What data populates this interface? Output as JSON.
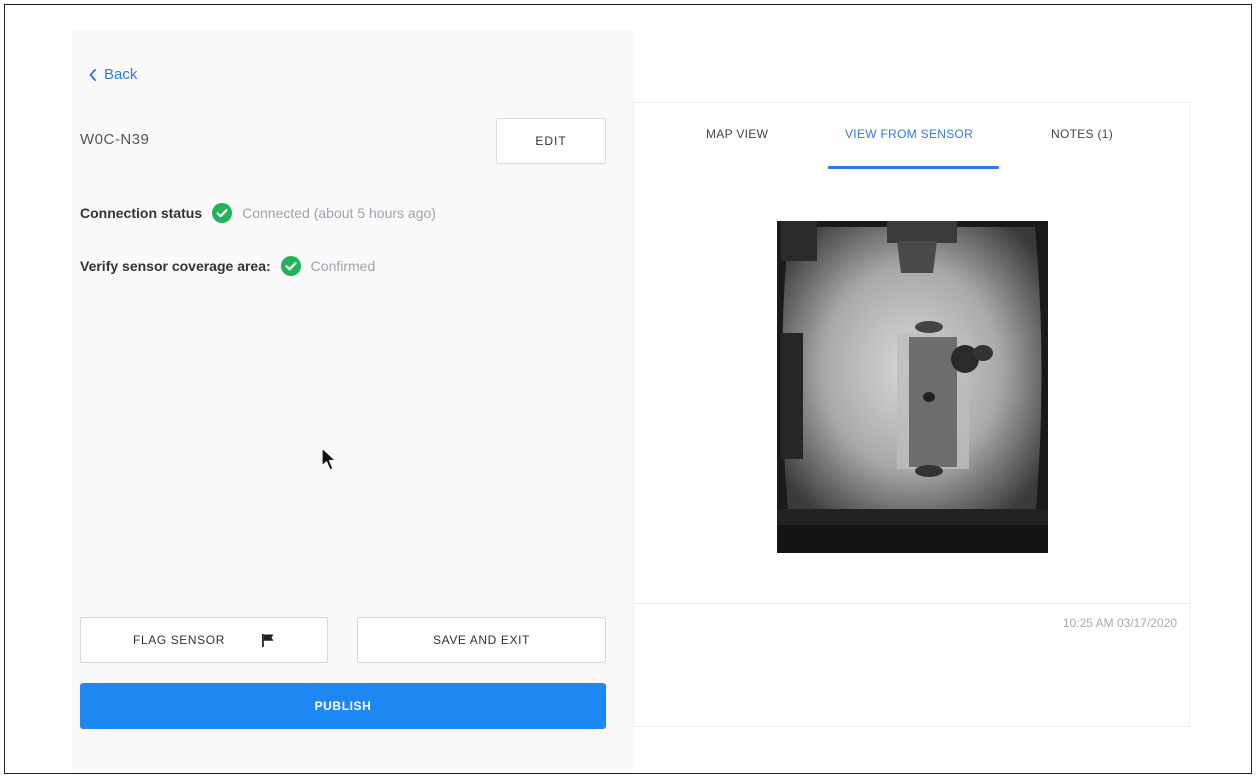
{
  "nav": {
    "back_label": "Back"
  },
  "sensor": {
    "id": "W0C-N39",
    "edit_label": "EDIT"
  },
  "status": {
    "connection": {
      "label": "Connection status",
      "value": "Connected (about 5 hours ago)"
    },
    "coverage": {
      "label": "Verify sensor coverage area:",
      "value": "Confirmed"
    }
  },
  "actions": {
    "flag_label": "FLAG SENSOR",
    "save_exit_label": "SAVE AND EXIT",
    "publish_label": "PUBLISH"
  },
  "panel": {
    "tabs": [
      {
        "label": "MAP VIEW",
        "active": false
      },
      {
        "label": "VIEW FROM SENSOR",
        "active": true
      },
      {
        "label": "NOTES (1)",
        "active": false
      }
    ],
    "timestamp": "10:25 AM 03/17/2020"
  },
  "colors": {
    "accent": "#2d7be5",
    "primary_button": "#1e88f2",
    "success": "#21b25a"
  },
  "icons": {
    "back": "chevron-left-icon",
    "status_ok": "check-circle-icon",
    "flag": "flag-icon",
    "cursor": "mouse-pointer-icon"
  }
}
